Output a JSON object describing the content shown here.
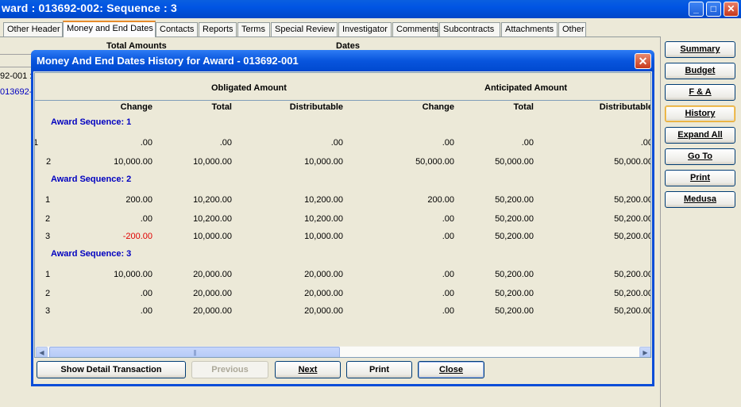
{
  "window": {
    "title": "ward : 013692-002: Sequence : 3",
    "minimize": "_",
    "maximize": "□",
    "close": "✕"
  },
  "tabs": [
    {
      "label": "Other Header"
    },
    {
      "label": "Money and End Dates"
    },
    {
      "label": "Contacts"
    },
    {
      "label": "Reports"
    },
    {
      "label": "Terms"
    },
    {
      "label": "Special Review"
    },
    {
      "label": "Investigator"
    },
    {
      "label": "Comments"
    },
    {
      "label": "Subcontracts"
    },
    {
      "label": "Attachments"
    },
    {
      "label": "Other"
    }
  ],
  "background": {
    "total_amounts": "Total Amounts",
    "dates": "Dates",
    "row1": "92-001 :",
    "row2": "013692-0"
  },
  "side_buttons": {
    "summary": "Summary",
    "budget": "Budget",
    "fa": "F & A",
    "history": "History",
    "expand_all": "Expand All",
    "go_to": "Go To",
    "print": "Print",
    "medusa": "Medusa"
  },
  "dialog": {
    "title": "Money And End Dates History for Award - 013692-001",
    "close": "✕",
    "group_obligated": "Obligated Amount",
    "group_anticipated": "Anticipated Amount",
    "columns": [
      "Change",
      "Total",
      "Distributable",
      "Change",
      "Total",
      "Distributable"
    ],
    "sequences": [
      {
        "label": "Award Sequence: 1",
        "rows": [
          {
            "num": "1",
            "values": [
              ".00",
              ".00",
              ".00",
              ".00",
              ".00",
              ".00"
            ]
          },
          {
            "num": "2",
            "values": [
              "10,000.00",
              "10,000.00",
              "10,000.00",
              "50,000.00",
              "50,000.00",
              "50,000.00"
            ]
          }
        ]
      },
      {
        "label": "Award Sequence: 2",
        "rows": [
          {
            "num": "1",
            "values": [
              "200.00",
              "10,200.00",
              "10,200.00",
              "200.00",
              "50,200.00",
              "50,200.00"
            ]
          },
          {
            "num": "2",
            "values": [
              ".00",
              "10,200.00",
              "10,200.00",
              ".00",
              "50,200.00",
              "50,200.00"
            ]
          },
          {
            "num": "3",
            "values": [
              "-200.00",
              "10,000.00",
              "10,000.00",
              ".00",
              "50,200.00",
              "50,200.00"
            ]
          }
        ]
      },
      {
        "label": "Award Sequence: 3",
        "rows": [
          {
            "num": "1",
            "values": [
              "10,000.00",
              "20,000.00",
              "20,000.00",
              ".00",
              "50,200.00",
              "50,200.00"
            ]
          },
          {
            "num": "2",
            "values": [
              ".00",
              "20,000.00",
              "20,000.00",
              ".00",
              "50,200.00",
              "50,200.00"
            ]
          },
          {
            "num": "3",
            "values": [
              ".00",
              "20,000.00",
              "20,000.00",
              ".00",
              "50,200.00",
              "50,200.00"
            ]
          }
        ]
      }
    ],
    "scroll_left": "◀",
    "scroll_right": "▶",
    "scroll_grip": "|||",
    "buttons": {
      "show_detail": "Show Detail Transaction",
      "previous": "Previous",
      "next": "Next",
      "print": "Print",
      "close": "Close"
    }
  },
  "colors": {
    "title_blue": "#0054e3",
    "sequence_label": "#0000c0",
    "negative": "#e00000",
    "face": "#ece9d8"
  }
}
